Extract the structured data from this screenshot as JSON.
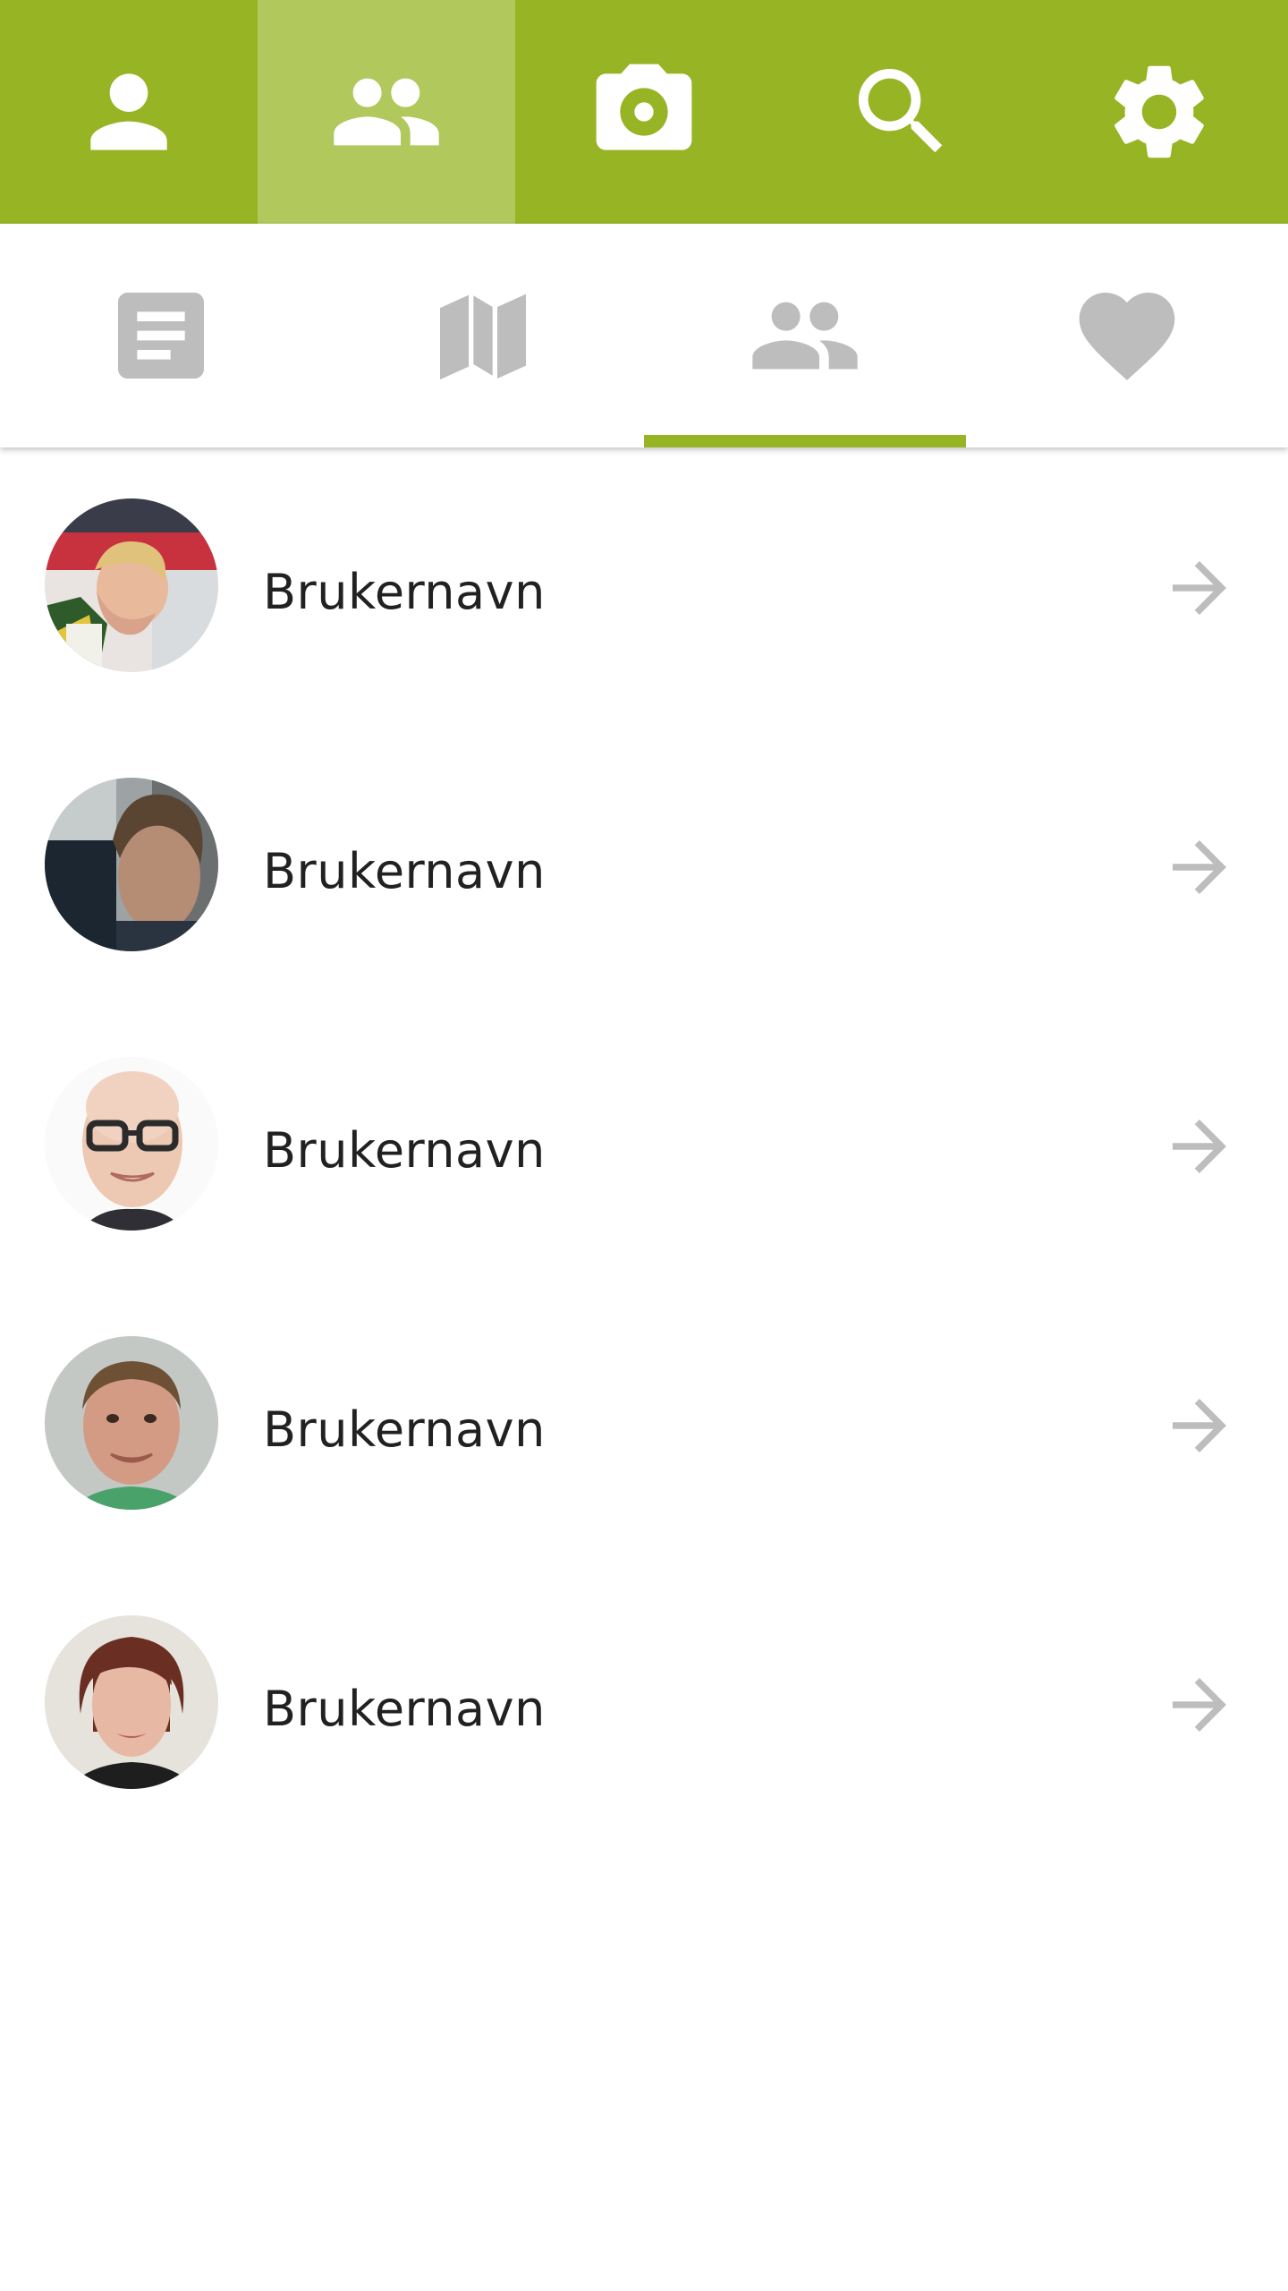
{
  "colors": {
    "accent": "#97b424",
    "accent_active": "#b1c85c",
    "icon_inactive": "#bdbdbd",
    "text_primary": "#212121",
    "background": "#ffffff"
  },
  "topbar": {
    "items": [
      {
        "icon": "person-icon",
        "active": false
      },
      {
        "icon": "people-icon",
        "active": true
      },
      {
        "icon": "camera-icon",
        "active": false
      },
      {
        "icon": "search-icon",
        "active": false
      },
      {
        "icon": "gear-icon",
        "active": false
      }
    ]
  },
  "subtabs": {
    "items": [
      {
        "icon": "article-icon",
        "active": false
      },
      {
        "icon": "map-icon",
        "active": false
      },
      {
        "icon": "people-icon",
        "active": true
      },
      {
        "icon": "heart-icon",
        "active": false
      }
    ]
  },
  "users": [
    {
      "name": "Brukernavn",
      "avatar": "avatar-photo-1"
    },
    {
      "name": "Brukernavn",
      "avatar": "avatar-photo-2"
    },
    {
      "name": "Brukernavn",
      "avatar": "avatar-photo-3"
    },
    {
      "name": "Brukernavn",
      "avatar": "avatar-photo-4"
    },
    {
      "name": "Brukernavn",
      "avatar": "avatar-photo-5"
    }
  ]
}
